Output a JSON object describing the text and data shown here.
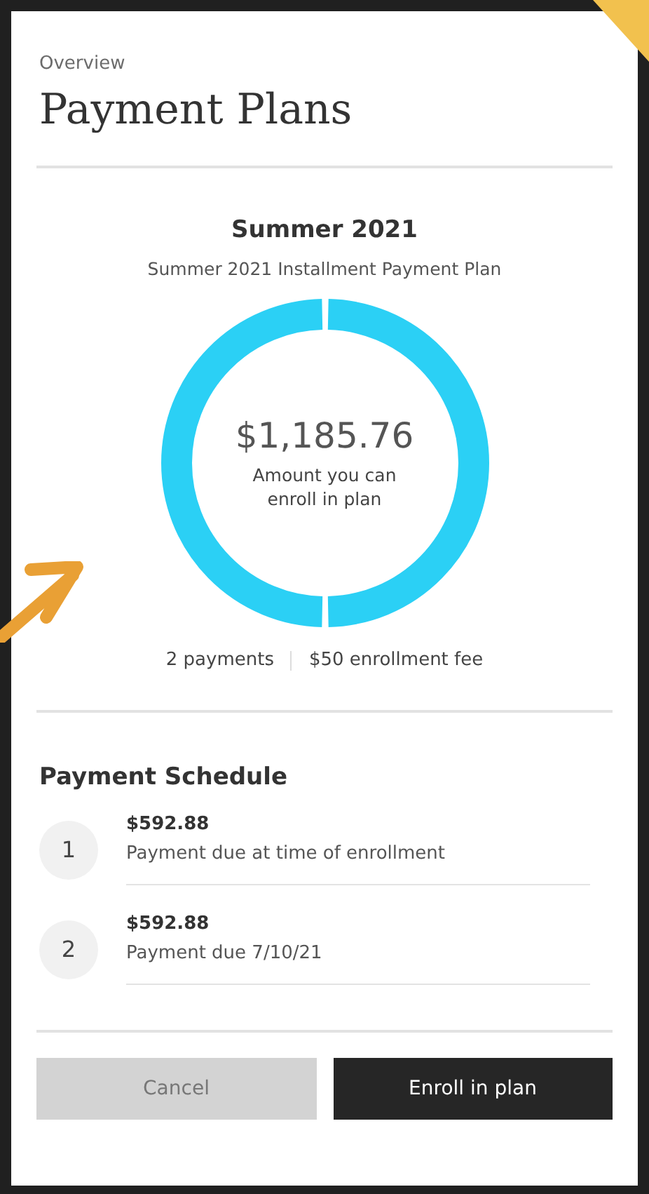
{
  "header": {
    "eyebrow": "Overview",
    "title": "Payment Plans"
  },
  "plan": {
    "term": "Summer 2021",
    "name": "Summer 2021 Installment Payment Plan",
    "amount": "$1,185.76",
    "amount_caption": "Amount you can enroll in plan",
    "payments": "2 payments",
    "fee": "$50 enrollment fee"
  },
  "schedule": {
    "title": "Payment Schedule",
    "items": [
      {
        "number": "1",
        "amount": "$592.88",
        "description": "Payment due at time of enrollment"
      },
      {
        "number": "2",
        "amount": "$592.88",
        "description": "Payment due 7/10/21"
      }
    ]
  },
  "buttons": [
    {
      "label": "Cancel",
      "kind": "secondary"
    },
    {
      "label": "Enroll in plan",
      "kind": "primary"
    }
  ]
}
